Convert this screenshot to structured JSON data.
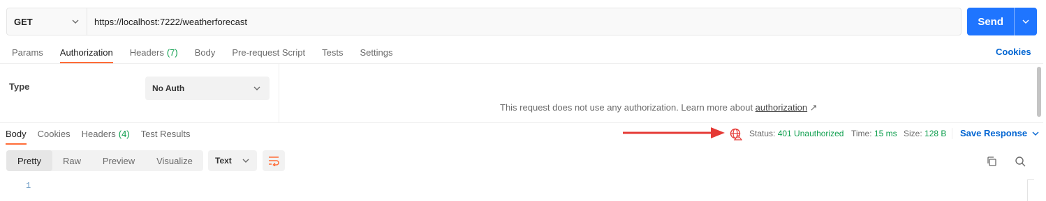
{
  "request": {
    "method": "GET",
    "url": "https://localhost:7222/weatherforecast",
    "send_label": "Send"
  },
  "request_tabs": [
    {
      "label": "Params",
      "count": ""
    },
    {
      "label": "Authorization",
      "count": "",
      "active": true
    },
    {
      "label": "Headers",
      "count": "(7)"
    },
    {
      "label": "Body",
      "count": ""
    },
    {
      "label": "Pre-request Script",
      "count": ""
    },
    {
      "label": "Tests",
      "count": ""
    },
    {
      "label": "Settings",
      "count": ""
    }
  ],
  "cookies_link": "Cookies",
  "auth": {
    "type_label": "Type",
    "type_value": "No Auth",
    "message": "This request does not use any authorization. Learn more about ",
    "link_text": "authorization",
    "link_arrow": "↗"
  },
  "response_tabs": [
    {
      "label": "Body",
      "count": "",
      "active": true
    },
    {
      "label": "Cookies",
      "count": ""
    },
    {
      "label": "Headers",
      "count": "(4)"
    },
    {
      "label": "Test Results",
      "count": ""
    }
  ],
  "response_meta": {
    "status_label": "Status:",
    "status_value": "401 Unauthorized",
    "time_label": "Time:",
    "time_value": "15 ms",
    "size_label": "Size:",
    "size_value": "128 B",
    "save_label": "Save Response"
  },
  "view_modes": [
    "Pretty",
    "Raw",
    "Preview",
    "Visualize"
  ],
  "active_view_mode": "Pretty",
  "format": "Text",
  "line_numbers": [
    "1"
  ],
  "colors": {
    "accent": "#ff6c37",
    "send": "#1f75ff",
    "link": "#0265d2",
    "status_ok": "#0a9d4b",
    "annotation_arrow": "#e53935"
  }
}
